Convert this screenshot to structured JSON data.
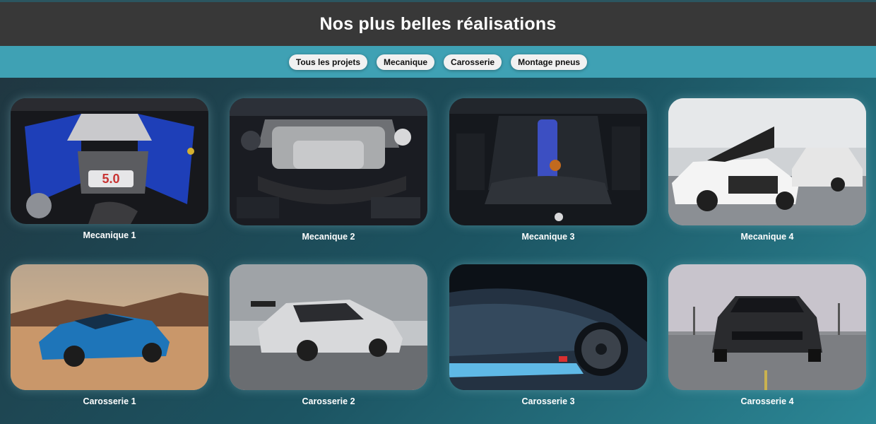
{
  "header": {
    "title": "Nos plus belles réalisations"
  },
  "filters": [
    {
      "label": "Tous les projets"
    },
    {
      "label": "Mecanique"
    },
    {
      "label": "Carosserie"
    },
    {
      "label": "Montage pneus"
    }
  ],
  "projects": [
    {
      "caption": "Mecanique 1",
      "image": "v8-engine-bay-blue-covers"
    },
    {
      "caption": "Mecanique 2",
      "image": "engine-bay-silver-intake"
    },
    {
      "caption": "Mecanique 3",
      "image": "dark-engine-bay-blue-lights"
    },
    {
      "caption": "Mecanique 4",
      "image": "white-gtr-hood-open-garage"
    },
    {
      "caption": "Carosserie 1",
      "image": "blue-camaro-desert-sunset"
    },
    {
      "caption": "Carosserie 2",
      "image": "silver-porsche-gt2rs"
    },
    {
      "caption": "Carosserie 3",
      "image": "dark-sports-car-closeup"
    },
    {
      "caption": "Carosserie 4",
      "image": "black-mustang-parking-lot"
    }
  ]
}
